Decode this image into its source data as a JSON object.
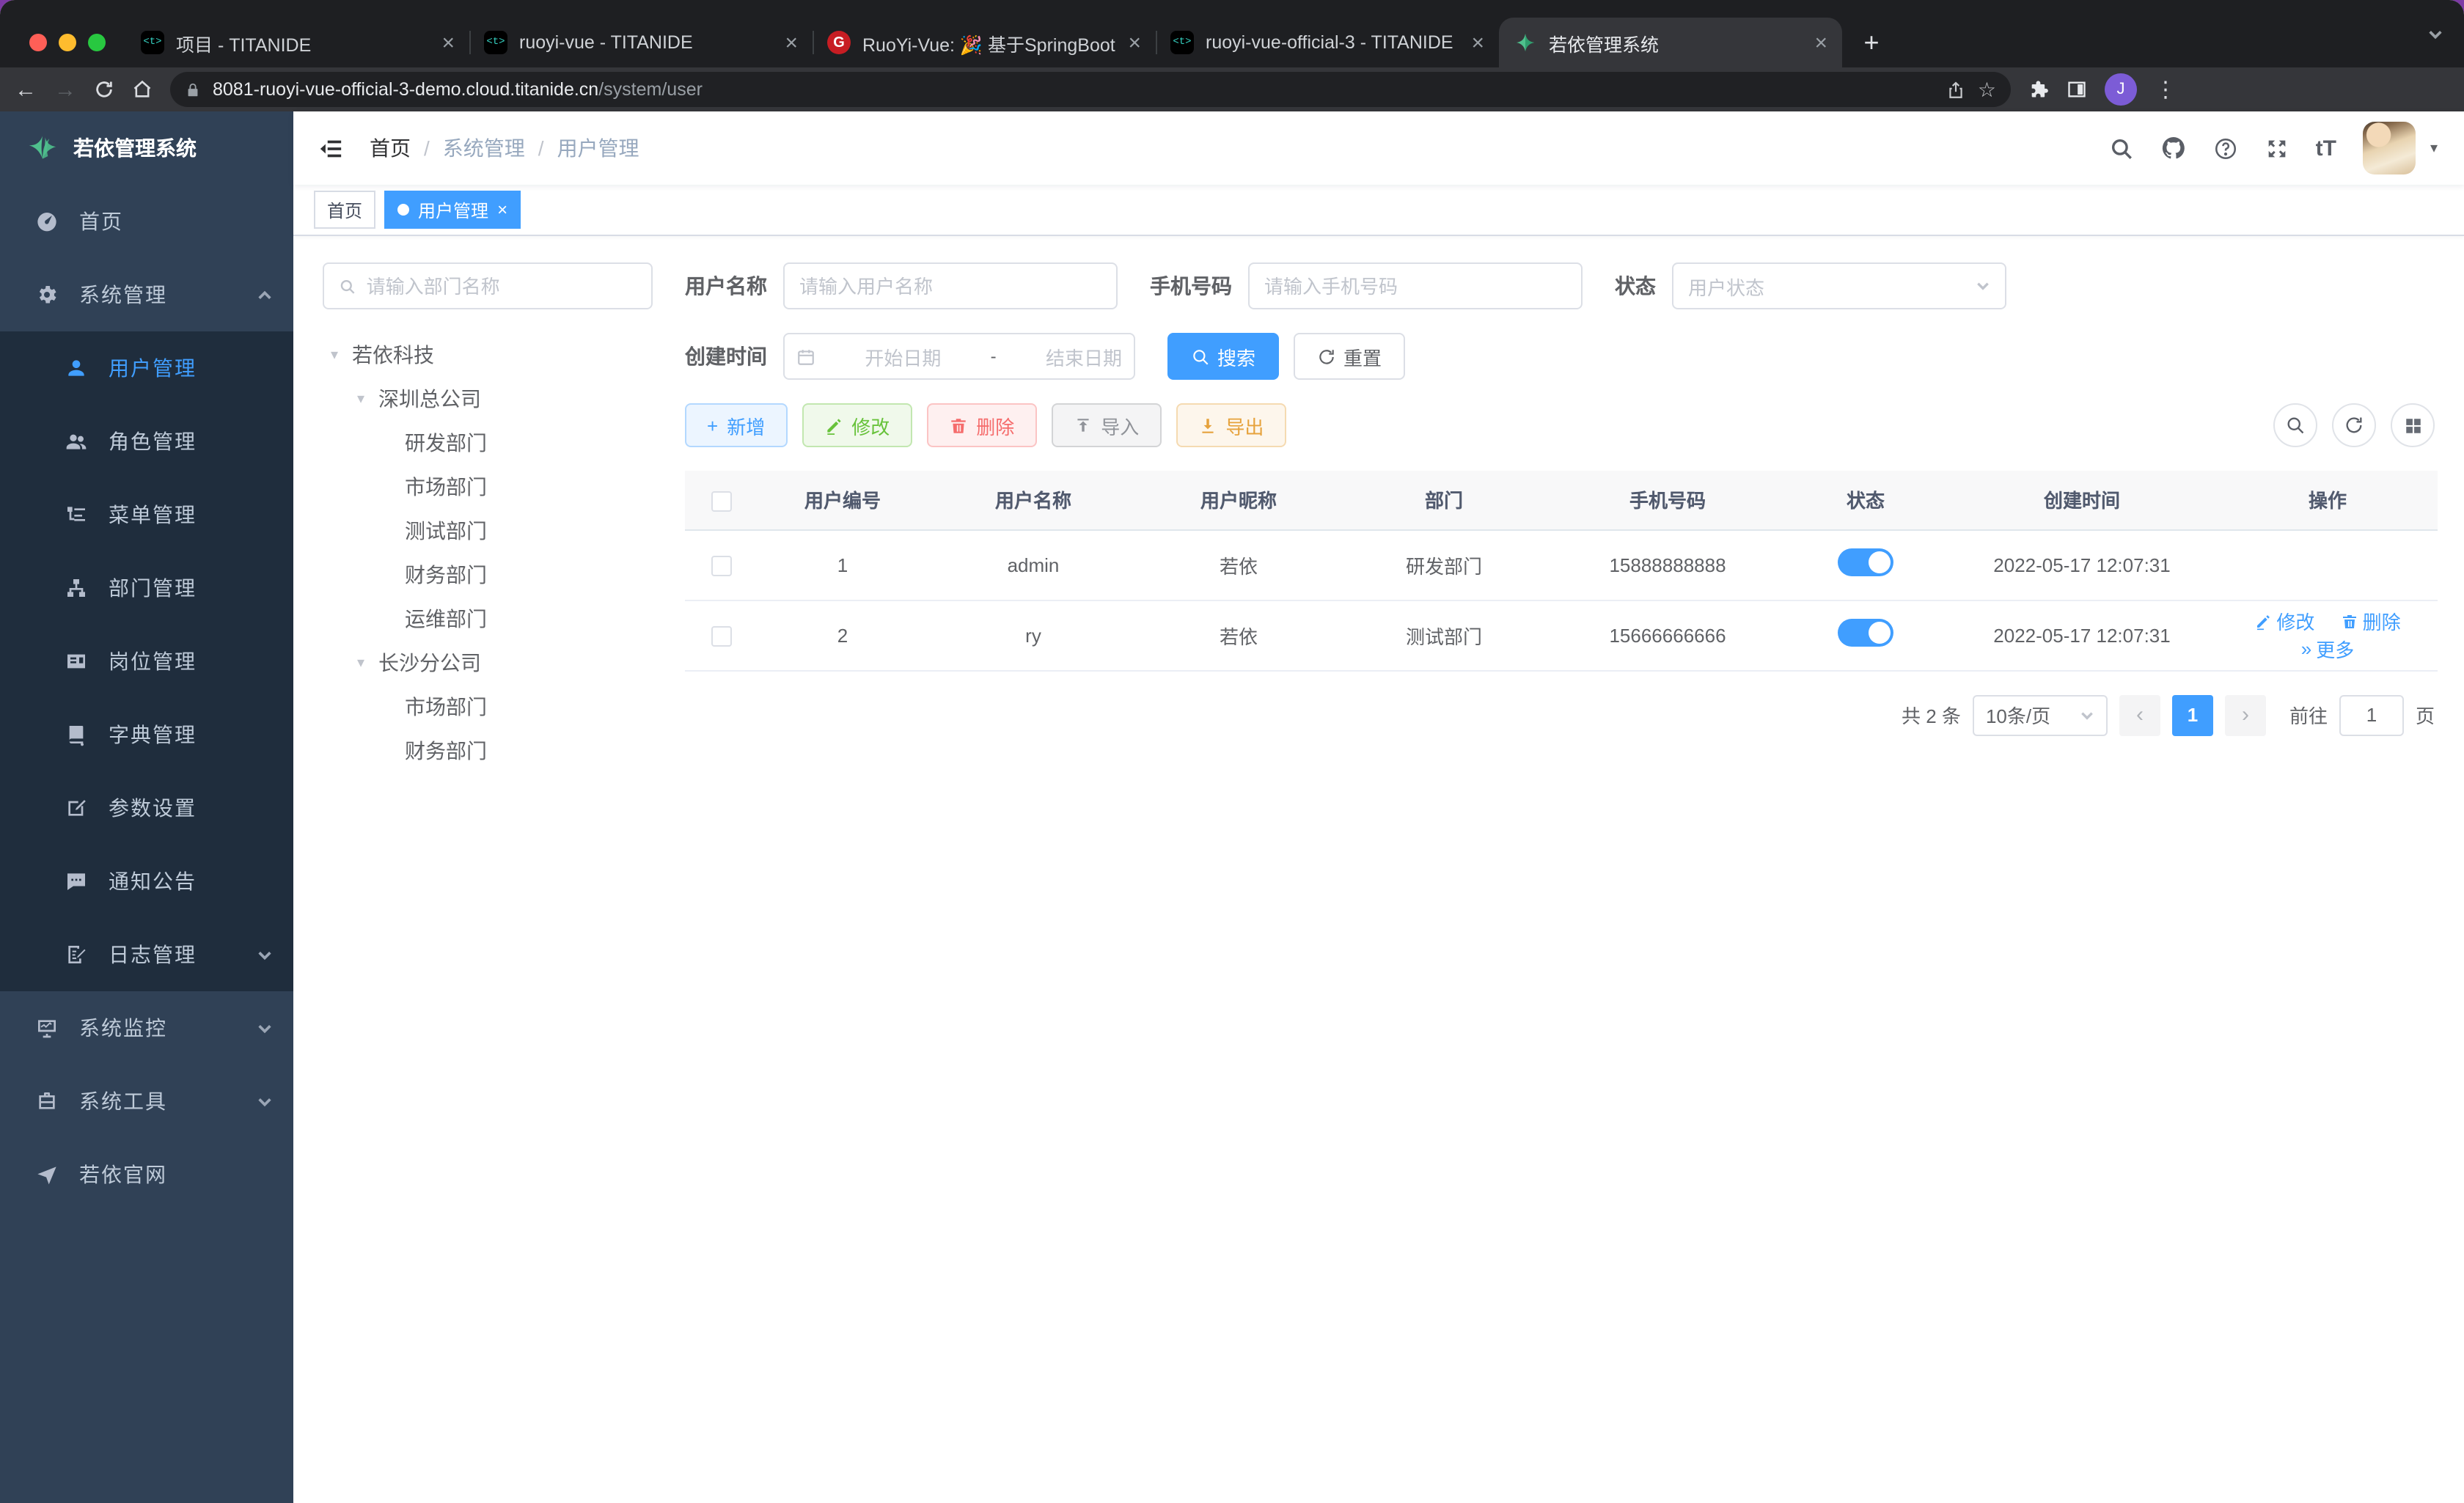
{
  "colors": {
    "accent": "#409eff",
    "success": "#67c23a",
    "danger": "#f56c6c",
    "warning": "#e6a23c",
    "info": "#909399",
    "sidebar_bg": "#304156",
    "submenu_bg": "#1f2d3d",
    "tab_active_bg": "#35363a",
    "browser_avatar_bg": "#7c5cd6",
    "traffic": [
      "#ff5f57",
      "#febc2e",
      "#28c840"
    ]
  },
  "browser": {
    "favicon_glyphs": {
      "titanide": "<t>",
      "gitee": "G"
    },
    "tabs": [
      {
        "title": "项目 - TITANIDE"
      },
      {
        "title": "ruoyi-vue - TITANIDE"
      },
      {
        "title": "RuoYi-Vue: 🎉 基于SpringBoot"
      },
      {
        "title": "ruoyi-vue-official-3 - TITANIDE"
      },
      {
        "title": "若依管理系统"
      }
    ],
    "close_glyph": "×",
    "new_tab_glyph": "+",
    "back_glyph": "←",
    "forward_glyph": "→",
    "url_host": "8081-ruoyi-vue-official-3-demo.cloud.titanide.cn",
    "url_path": "/system/user",
    "star_glyph": "☆",
    "kebab_glyph": "⋮",
    "avatar_initial": "J"
  },
  "sidebar": {
    "logo": "若依管理系统",
    "home": "首页",
    "system": "系统管理",
    "user": "用户管理",
    "role": "角色管理",
    "menu": "菜单管理",
    "dept": "部门管理",
    "post": "岗位管理",
    "dict": "字典管理",
    "config": "参数设置",
    "notice": "通知公告",
    "log": "日志管理",
    "monitor": "系统监控",
    "tool": "系统工具",
    "site": "若依官网"
  },
  "navbar": {
    "breadcrumb": {
      "home": "首页",
      "system": "系统管理",
      "user": "用户管理"
    },
    "font_size_glyph": "tT",
    "caret_glyph": "▾"
  },
  "tags": {
    "home": "首页",
    "user": "用户管理",
    "close_glyph": "×"
  },
  "filters": {
    "username_label": "用户名称",
    "username_placeholder": "请输入用户名称",
    "phone_label": "手机号码",
    "phone_placeholder": "请输入手机号码",
    "status_label": "状态",
    "status_placeholder": "用户状态",
    "created_label": "创建时间",
    "start_placeholder": "开始日期",
    "range_separator": "-",
    "end_placeholder": "结束日期",
    "search": "搜索",
    "reset": "重置"
  },
  "tree": {
    "search_placeholder": "请输入部门名称",
    "caret_glyph": "▾",
    "nodes": [
      {
        "label": "若依科技"
      },
      {
        "label": "深圳总公司"
      },
      {
        "label": "研发部门"
      },
      {
        "label": "市场部门"
      },
      {
        "label": "测试部门"
      },
      {
        "label": "财务部门"
      },
      {
        "label": "运维部门"
      },
      {
        "label": "长沙分公司"
      },
      {
        "label": "市场部门"
      },
      {
        "label": "财务部门"
      }
    ]
  },
  "actions": {
    "add": "新增",
    "add_glyph": "+",
    "edit": "修改",
    "delete": "删除",
    "import": "导入",
    "export": "导出"
  },
  "table": {
    "headers": {
      "id": "用户编号",
      "username": "用户名称",
      "nickname": "用户昵称",
      "dept": "部门",
      "phone": "手机号码",
      "status": "状态",
      "created": "创建时间",
      "ops": "操作"
    },
    "rows": [
      {
        "id": "1",
        "username": "admin",
        "nickname": "若依",
        "dept": "研发部门",
        "phone": "15888888888",
        "created": "2022-05-17 12:07:31"
      },
      {
        "id": "2",
        "username": "ry",
        "nickname": "若依",
        "dept": "测试部门",
        "phone": "15666666666",
        "created": "2022-05-17 12:07:31",
        "ops": {
          "edit": "修改",
          "delete": "删除",
          "more": "更多",
          "more_glyph": "»"
        }
      }
    ]
  },
  "pagination": {
    "total": "共 2 条",
    "size": "10条/页",
    "prev_glyph": "‹",
    "page": "1",
    "next_glyph": "›",
    "goto": "前往",
    "goto_value": "1",
    "unit": "页"
  }
}
